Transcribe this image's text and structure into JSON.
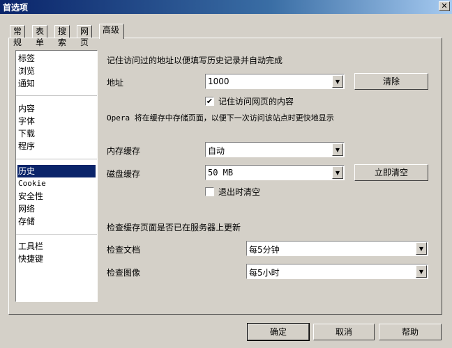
{
  "window": {
    "title": "首选项",
    "close_glyph": "✕"
  },
  "tabs": [
    {
      "label": "常规"
    },
    {
      "label": "表单"
    },
    {
      "label": "搜索"
    },
    {
      "label": "网页"
    },
    {
      "label": "高级",
      "active": true
    }
  ],
  "sidebar": {
    "items": [
      {
        "label": "标签"
      },
      {
        "label": "浏览"
      },
      {
        "label": "通知"
      },
      {
        "label": "内容"
      },
      {
        "label": "字体"
      },
      {
        "label": "下载"
      },
      {
        "label": "程序"
      },
      {
        "label": "历史",
        "selected": true
      },
      {
        "label": "Cookie"
      },
      {
        "label": "安全性"
      },
      {
        "label": "网络"
      },
      {
        "label": "存储"
      },
      {
        "label": "工具栏"
      },
      {
        "label": "快捷键"
      }
    ]
  },
  "history": {
    "remember_heading": "记住访问过的地址以便填写历史记录并自动完成",
    "address_label": "地址",
    "address_value": "1000",
    "clear_button": "清除",
    "remember_content_label": "记住访问网页的内容",
    "remember_content_checked": "✔",
    "cache_note": "Opera 将在缓存中存储页面，以便下一次访问该站点时更快地显示",
    "memory_cache_label": "内存缓存",
    "memory_cache_value": "自动",
    "disk_cache_label": "磁盘缓存",
    "disk_cache_value": "50 MB",
    "empty_now_button": "立即清空",
    "empty_on_exit_label": "退出时清空",
    "empty_on_exit_checked": "",
    "check_heading": "检查缓存页面是否已在服务器上更新",
    "check_docs_label": "检查文档",
    "check_docs_value": "每5分钟",
    "check_images_label": "检查图像",
    "check_images_value": "每5小时"
  },
  "footer": {
    "ok": "确定",
    "cancel": "取消",
    "help": "帮助"
  },
  "icons": {
    "dropdown": "dropdown-arrow-icon",
    "check": "checkmark-icon",
    "close": "close-icon"
  },
  "colors": {
    "titlebar": "#0a246a",
    "selection": "#0a246a",
    "face": "#d4d0c8"
  }
}
